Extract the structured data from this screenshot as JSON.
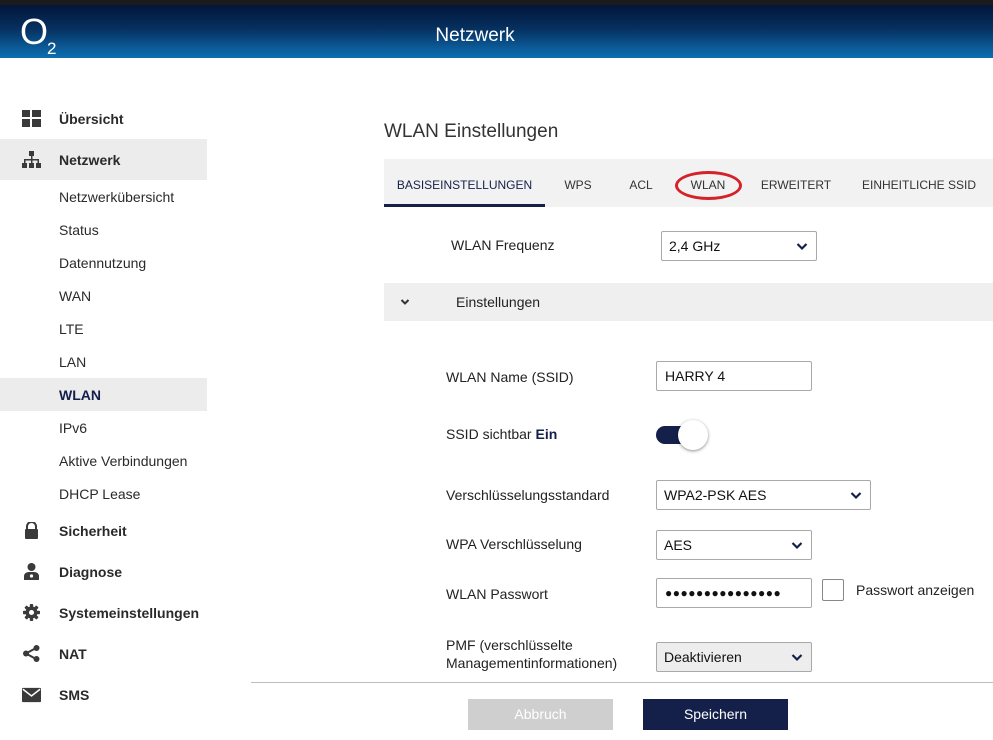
{
  "header": {
    "logo_main": "O",
    "logo_sub": "2",
    "title": "Netzwerk"
  },
  "sidebar": {
    "top": [
      {
        "label": "Übersicht",
        "icon": "dashboard-icon"
      },
      {
        "label": "Netzwerk",
        "icon": "network-icon",
        "active": true
      }
    ],
    "sub": [
      {
        "label": "Netzwerkübersicht"
      },
      {
        "label": "Status"
      },
      {
        "label": "Datennutzung"
      },
      {
        "label": "WAN"
      },
      {
        "label": "LTE"
      },
      {
        "label": "LAN"
      },
      {
        "label": "WLAN",
        "active": true
      },
      {
        "label": "IPv6"
      },
      {
        "label": "Aktive Verbindungen"
      },
      {
        "label": "DHCP Lease"
      }
    ],
    "bottom": [
      {
        "label": "Sicherheit",
        "icon": "lock-icon"
      },
      {
        "label": "Diagnose",
        "icon": "doctor-icon"
      },
      {
        "label": "Systemeinstellungen",
        "icon": "gear-icon"
      },
      {
        "label": "NAT",
        "icon": "share-icon"
      },
      {
        "label": "SMS",
        "icon": "envelope-icon"
      }
    ]
  },
  "main": {
    "title": "WLAN Einstellungen",
    "tabs": [
      "BASISEINSTELLUNGEN",
      "WPS",
      "ACL",
      "WLAN",
      "ERWEITERT",
      "EINHEITLICHE SSID"
    ],
    "frequency": {
      "label": "WLAN Frequenz",
      "value": "2,4 GHz"
    },
    "section": {
      "label": "Einstellungen"
    },
    "ssid_name": {
      "label": "WLAN Name (SSID)",
      "value": "HARRY 4"
    },
    "ssid_visible": {
      "label": "SSID sichtbar",
      "state": "Ein",
      "on": true
    },
    "encryption_standard": {
      "label": "Verschlüsselungsstandard",
      "value": "WPA2-PSK AES"
    },
    "wpa_encryption": {
      "label": "WPA Verschlüsselung",
      "value": "AES"
    },
    "password": {
      "label": "WLAN Passwort",
      "value": "●●●●●●●●●●●●●●●",
      "show_label": "Passwort anzeigen"
    },
    "pmf": {
      "label_line1": "PMF (verschlüsselte",
      "label_line2": "Managementinformationen)",
      "value": "Deaktivieren"
    },
    "buttons": {
      "cancel": "Abbruch",
      "save": "Speichern"
    }
  },
  "colors": {
    "accent": "#14204a",
    "highlight": "#d4222a",
    "nav_active_bg": "#ececec"
  }
}
